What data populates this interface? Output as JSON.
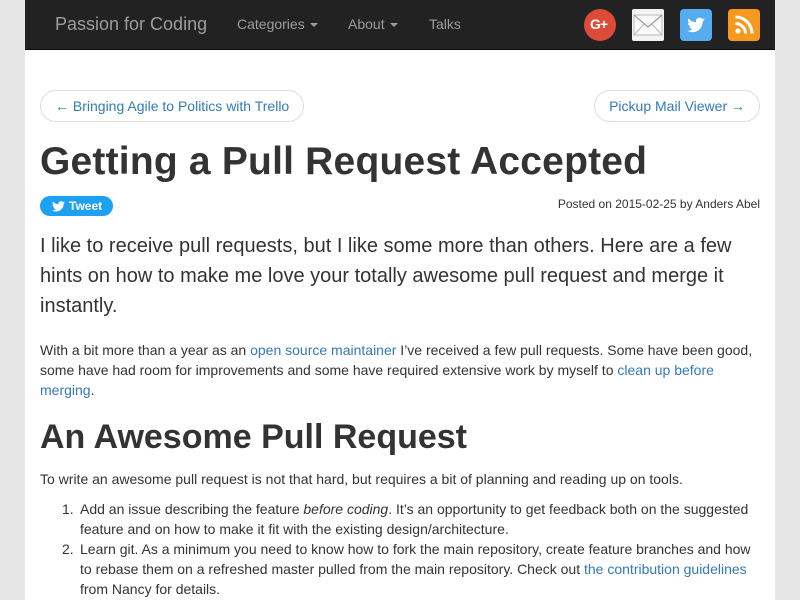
{
  "navbar": {
    "brand": "Passion for Coding",
    "items": [
      {
        "label": "Categories",
        "dropdown": true
      },
      {
        "label": "About",
        "dropdown": true
      },
      {
        "label": "Talks",
        "dropdown": false
      }
    ],
    "social": {
      "gplus_label": "G+",
      "icons": [
        "google-plus-icon",
        "mail-icon",
        "twitter-icon",
        "rss-icon"
      ],
      "colors": {
        "gplus": "#dc4a38",
        "twitter": "#55acee",
        "rss": "#f6991e",
        "mail": "#f3f3f3"
      }
    }
  },
  "pager": {
    "prev": "← Bringing Agile to Politics with Trello",
    "next": "Pickup Mail Viewer →"
  },
  "post": {
    "title": "Getting a Pull Request Accepted",
    "tweet_label": "Tweet",
    "meta": "Posted on 2015-02-25 by Anders Abel",
    "lead": "I like to receive pull requests, but I like some more than others. Here are a few hints on how to make me love your totally awesome pull request and merge it instantly.",
    "intro": {
      "t1": "With a bit more than a year as an ",
      "link1": "open source maintainer",
      "t2": " I’ve received a few pull requests. Some have been good, some have had room for improvements and some have required extensive work by myself to ",
      "link2": "clean up before merging",
      "t3": "."
    },
    "section_heading": "An Awesome Pull Request",
    "section_intro": "To write an awesome pull request is not that hard, but requires a bit of planning and reading up on tools.",
    "list": [
      {
        "num": "1.",
        "t1": "Add an issue describing the feature ",
        "em": "before coding",
        "t2": ". It’s an opportunity to get feedback both on the suggested feature and on how to make it fit with the existing design/architecture."
      },
      {
        "num": "2.",
        "t1": "Learn git. As a minimum you need to know how to fork the main repository, create feature branches and how to rebase them on a refreshed master pulled from the main repository. Check out ",
        "link": "the contribution guidelines",
        "t2": " from Nancy for details."
      }
    ]
  },
  "colors": {
    "navbar_bg": "#222222",
    "link": "#337ab7",
    "tweet": "#1da1f2"
  }
}
